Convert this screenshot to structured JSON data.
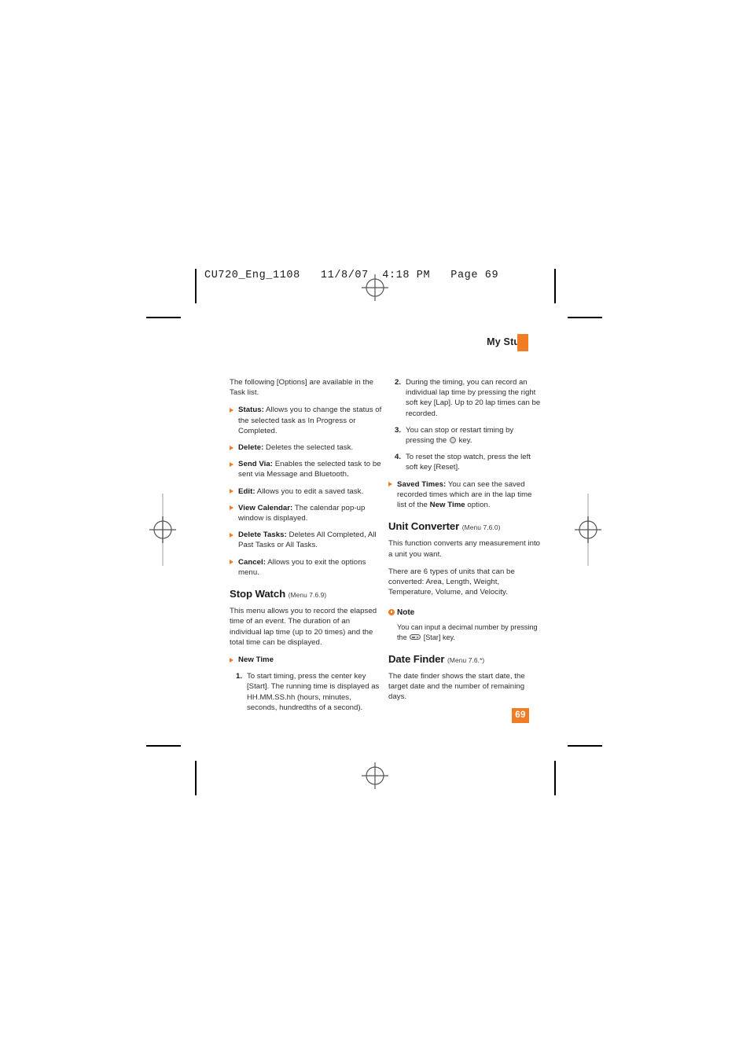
{
  "print_slug": {
    "text": "CU720_Eng_1108   11/8/07  4:18 PM   Page 69"
  },
  "header": {
    "running_title": "My Stuff",
    "accent_color": "#f07d23"
  },
  "folio": {
    "page_number": "69"
  },
  "left_column": {
    "intro": "The following [Options] are available in the Task list.",
    "options": [
      {
        "term": "Status:",
        "desc": " Allows you to change the status of the selected task as In Progress or Completed."
      },
      {
        "term": "Delete:",
        "desc": " Deletes the selected task."
      },
      {
        "term": "Send Via:",
        "desc": " Enables the selected task to be sent via Message and Bluetooth."
      },
      {
        "term": "Edit:",
        "desc": " Allows you to edit a saved task."
      },
      {
        "term": "View Calendar:",
        "desc": " The calendar pop-up window is displayed."
      },
      {
        "term": "Delete Tasks:",
        "desc": " Deletes All Completed, All Past Tasks or All Tasks."
      },
      {
        "term": "Cancel:",
        "desc": " Allows you to exit the options menu."
      }
    ],
    "stop_watch": {
      "heading": "Stop Watch",
      "menu_ref": "(Menu 7.6.9)",
      "body": "This menu allows you to record the elapsed time of an event. The duration of an individual lap time (up to 20 times) and the total time can be displayed.",
      "new_time_label": "New Time",
      "step_1_num": "1.",
      "step_1_text": "To start timing, press the center key [Start]. The running time is displayed as HH.MM.SS.hh (hours, minutes, seconds, hundredths of a second)."
    }
  },
  "right_column": {
    "step_2_num": "2.",
    "step_2_text": "During the timing, you can record an individual lap time by pressing the right soft key [Lap]. Up to 20 lap times can be recorded.",
    "step_3_num": "3.",
    "step_3_text_before": "You can stop or restart timing by pressing the ",
    "step_3_text_after": " key.",
    "step_4_num": "4.",
    "step_4_text": "To reset the stop watch, press the left soft key [Reset].",
    "saved_times": {
      "term": "Saved Times:",
      "desc_before": " You can see the saved recorded times which are in the lap time list of the ",
      "desc_bold": "New Time",
      "desc_after": " option."
    },
    "unit_converter": {
      "heading": "Unit Converter",
      "menu_ref": "(Menu 7.6.0)",
      "para_1": "This function converts any measurement into a unit you want.",
      "para_2": "There are 6 types of units that can be converted: Area, Length, Weight, Temperature, Volume, and Velocity."
    },
    "note": {
      "label": "Note",
      "text_before": "You can input a decimal number by pressing the ",
      "text_after": " [Star] key."
    },
    "date_finder": {
      "heading": "Date Finder",
      "menu_ref": "(Menu 7.6.*)",
      "body": "The date finder shows the start date, the target date and the number of remaining days."
    }
  }
}
